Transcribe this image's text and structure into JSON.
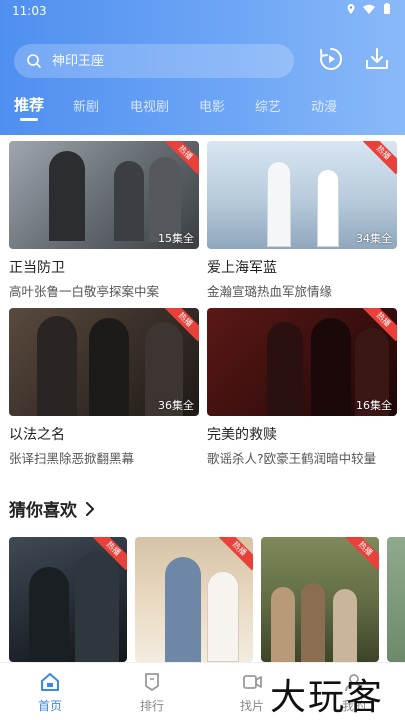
{
  "status_bar": {
    "time": "11:03"
  },
  "search": {
    "placeholder": "神印王座"
  },
  "tabs": [
    {
      "label": "推荐",
      "active": true
    },
    {
      "label": "新剧"
    },
    {
      "label": "电视剧"
    },
    {
      "label": "电影"
    },
    {
      "label": "综艺"
    },
    {
      "label": "动漫"
    }
  ],
  "grid": [
    {
      "title": "正当防卫",
      "subtitle": "高叶张鲁一白敬亭探案中案",
      "episodes": "15集全",
      "badge": "热播"
    },
    {
      "title": "爱上海军蓝",
      "subtitle": "金瀚宣璐热血军旅情缘",
      "episodes": "34集全",
      "badge": "热播"
    },
    {
      "title": "以法之名",
      "subtitle": "张译扫黑除恶掀翻黑幕",
      "episodes": "36集全",
      "badge": "热播"
    },
    {
      "title": "完美的救赎",
      "subtitle": "歌谣杀人?欧豪王鹤润暗中较量",
      "episodes": "16集全",
      "badge": "热播"
    }
  ],
  "section": {
    "title": "猜你喜欢"
  },
  "recommend_badges": [
    "热播",
    "热播",
    "热播"
  ],
  "bottom_nav": [
    {
      "label": "首页",
      "icon": "home-icon",
      "active": true
    },
    {
      "label": "排行",
      "icon": "ranking-icon"
    },
    {
      "label": "找片",
      "icon": "film-search-icon"
    },
    {
      "label": "我的",
      "icon": "profile-icon"
    }
  ],
  "watermark": "大玩客",
  "colors": {
    "accent": "#3a86f2",
    "header_start": "#4f8ff0",
    "badge": "#e9413a"
  }
}
